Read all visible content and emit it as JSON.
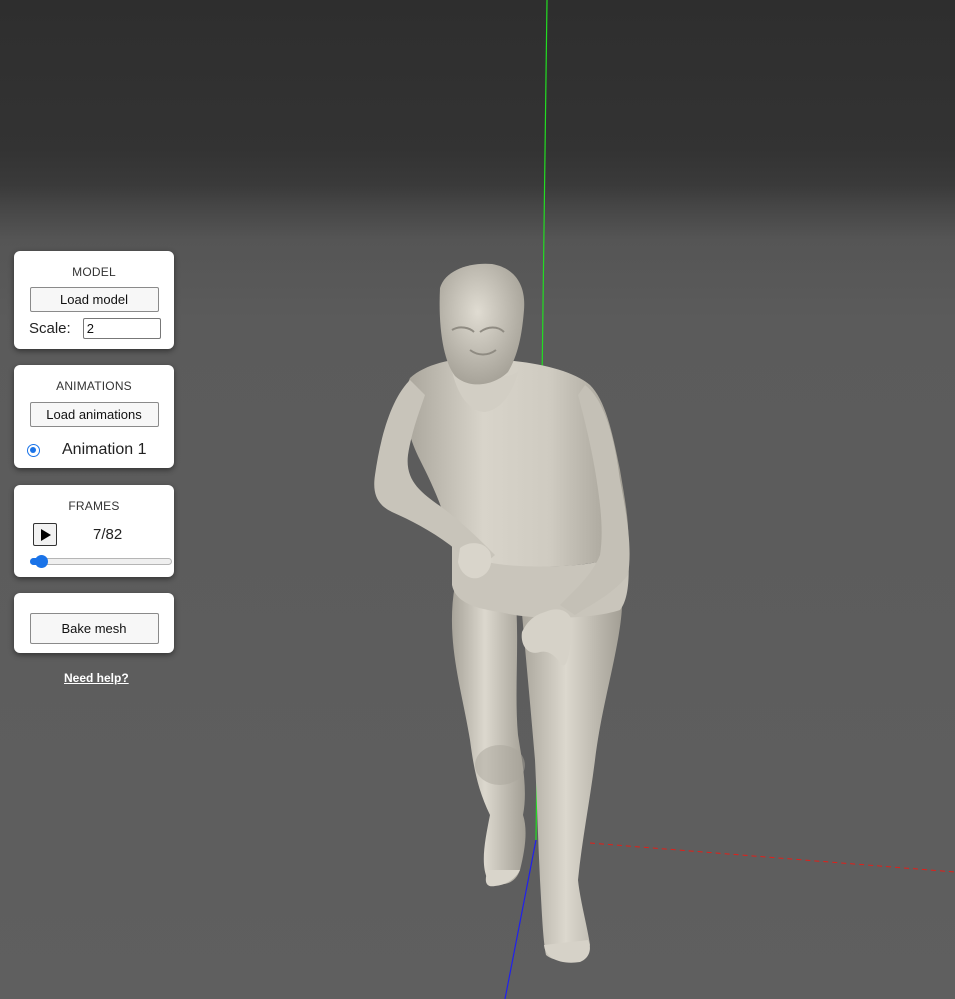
{
  "model_panel": {
    "title": "MODEL",
    "load_button": "Load model",
    "scale_label": "Scale:",
    "scale_value": "2"
  },
  "animations_panel": {
    "title": "ANIMATIONS",
    "load_button": "Load animations",
    "items": [
      {
        "label": "Animation 1",
        "selected": true
      }
    ]
  },
  "frames_panel": {
    "title": "FRAMES",
    "play_icon": "play-icon",
    "counter": "7/82",
    "current_frame": 7,
    "total_frames": 82
  },
  "bake_panel": {
    "bake_button": "Bake mesh"
  },
  "help_link": "Need help?",
  "scene": {
    "background_top": "#2e2e2e",
    "background_bottom": "#5f5f5f",
    "axis_x_color": "#e0201a",
    "axis_y_color": "#22dd22",
    "axis_z_color": "#2020ee",
    "mesh_color": "#d6d2c8"
  }
}
